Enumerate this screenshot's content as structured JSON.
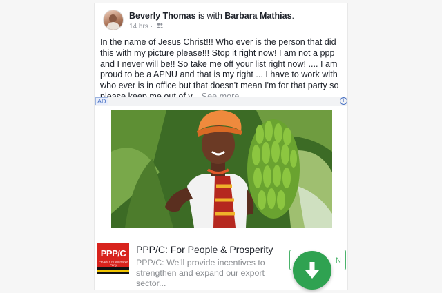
{
  "post": {
    "author": "Beverly Thomas",
    "connector": " is with ",
    "tagged": "Barbara Mathias",
    "tagged_suffix": ".",
    "time": "14 hrs",
    "separator": " · ",
    "audience_icon": "friends-icon",
    "body": "In the name of Jesus Christ!!! Who ever is the person that did this with my picture please!!! Stop it right now! I am not a ppp and I never will be!! So take me off your list right now! .... I am proud to be a APNU and that is my  right ... I have to work with who ever is in office but that doesn't mean I'm for that party so please keep me out of y...",
    "see_more": " See more"
  },
  "ad": {
    "label": "AD",
    "info_icon": "info-icon",
    "logo_text": "PPP/C",
    "logo_subtext": "People's Progressive Party",
    "title": "PPP/C: For People & Prosperity",
    "description": "PPP/C: We'll provide incentives to strengthen and expand our export sector...",
    "button_label": "N",
    "download_icon": "download-arrow-icon"
  },
  "colors": {
    "text": "#1d2129",
    "meta": "#90949c",
    "ppp_red": "#d8231d",
    "green": "#2fa251"
  }
}
